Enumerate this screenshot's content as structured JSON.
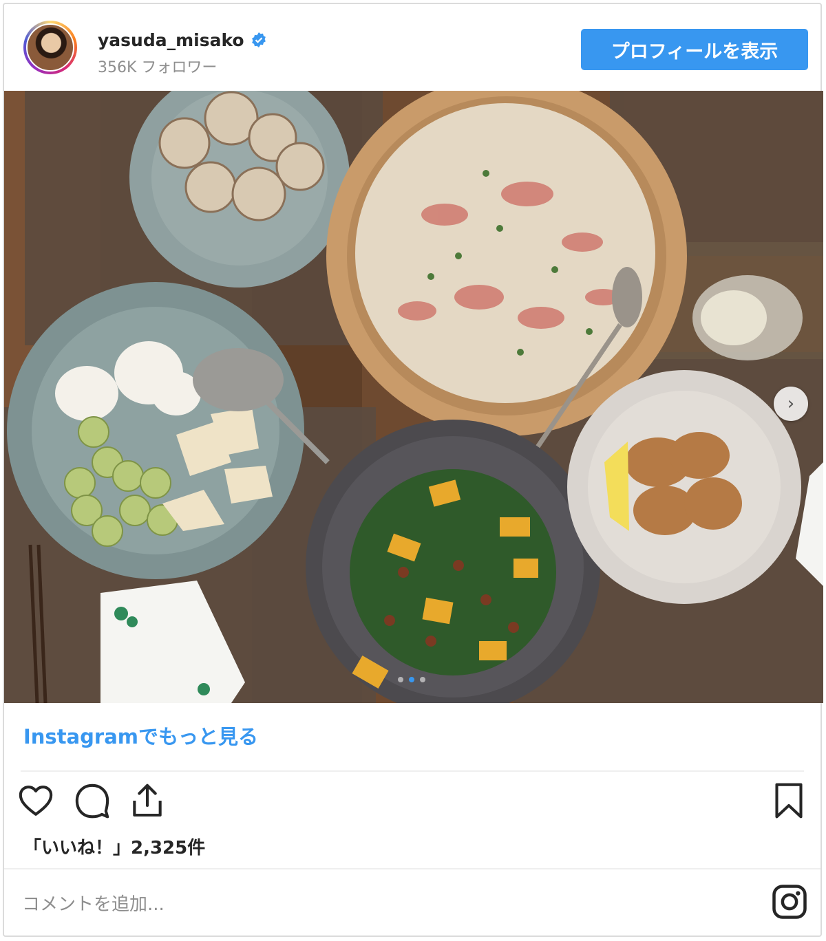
{
  "header": {
    "username": "yasuda_misako",
    "followers": "356K フォロワー",
    "profile_button": "プロフィールを表示"
  },
  "post": {
    "more_link": "Instagramでもっと見る",
    "likes": "「いいね！」2,325件",
    "comment_placeholder": "コメントを追加..."
  },
  "colors": {
    "accent": "#3897f0",
    "text": "#262626",
    "muted": "#8e8e8e"
  },
  "icons": [
    "verified-badge-icon",
    "heart-icon",
    "comment-icon",
    "share-icon",
    "bookmark-icon",
    "instagram-logo-icon",
    "chevron-right-icon"
  ]
}
